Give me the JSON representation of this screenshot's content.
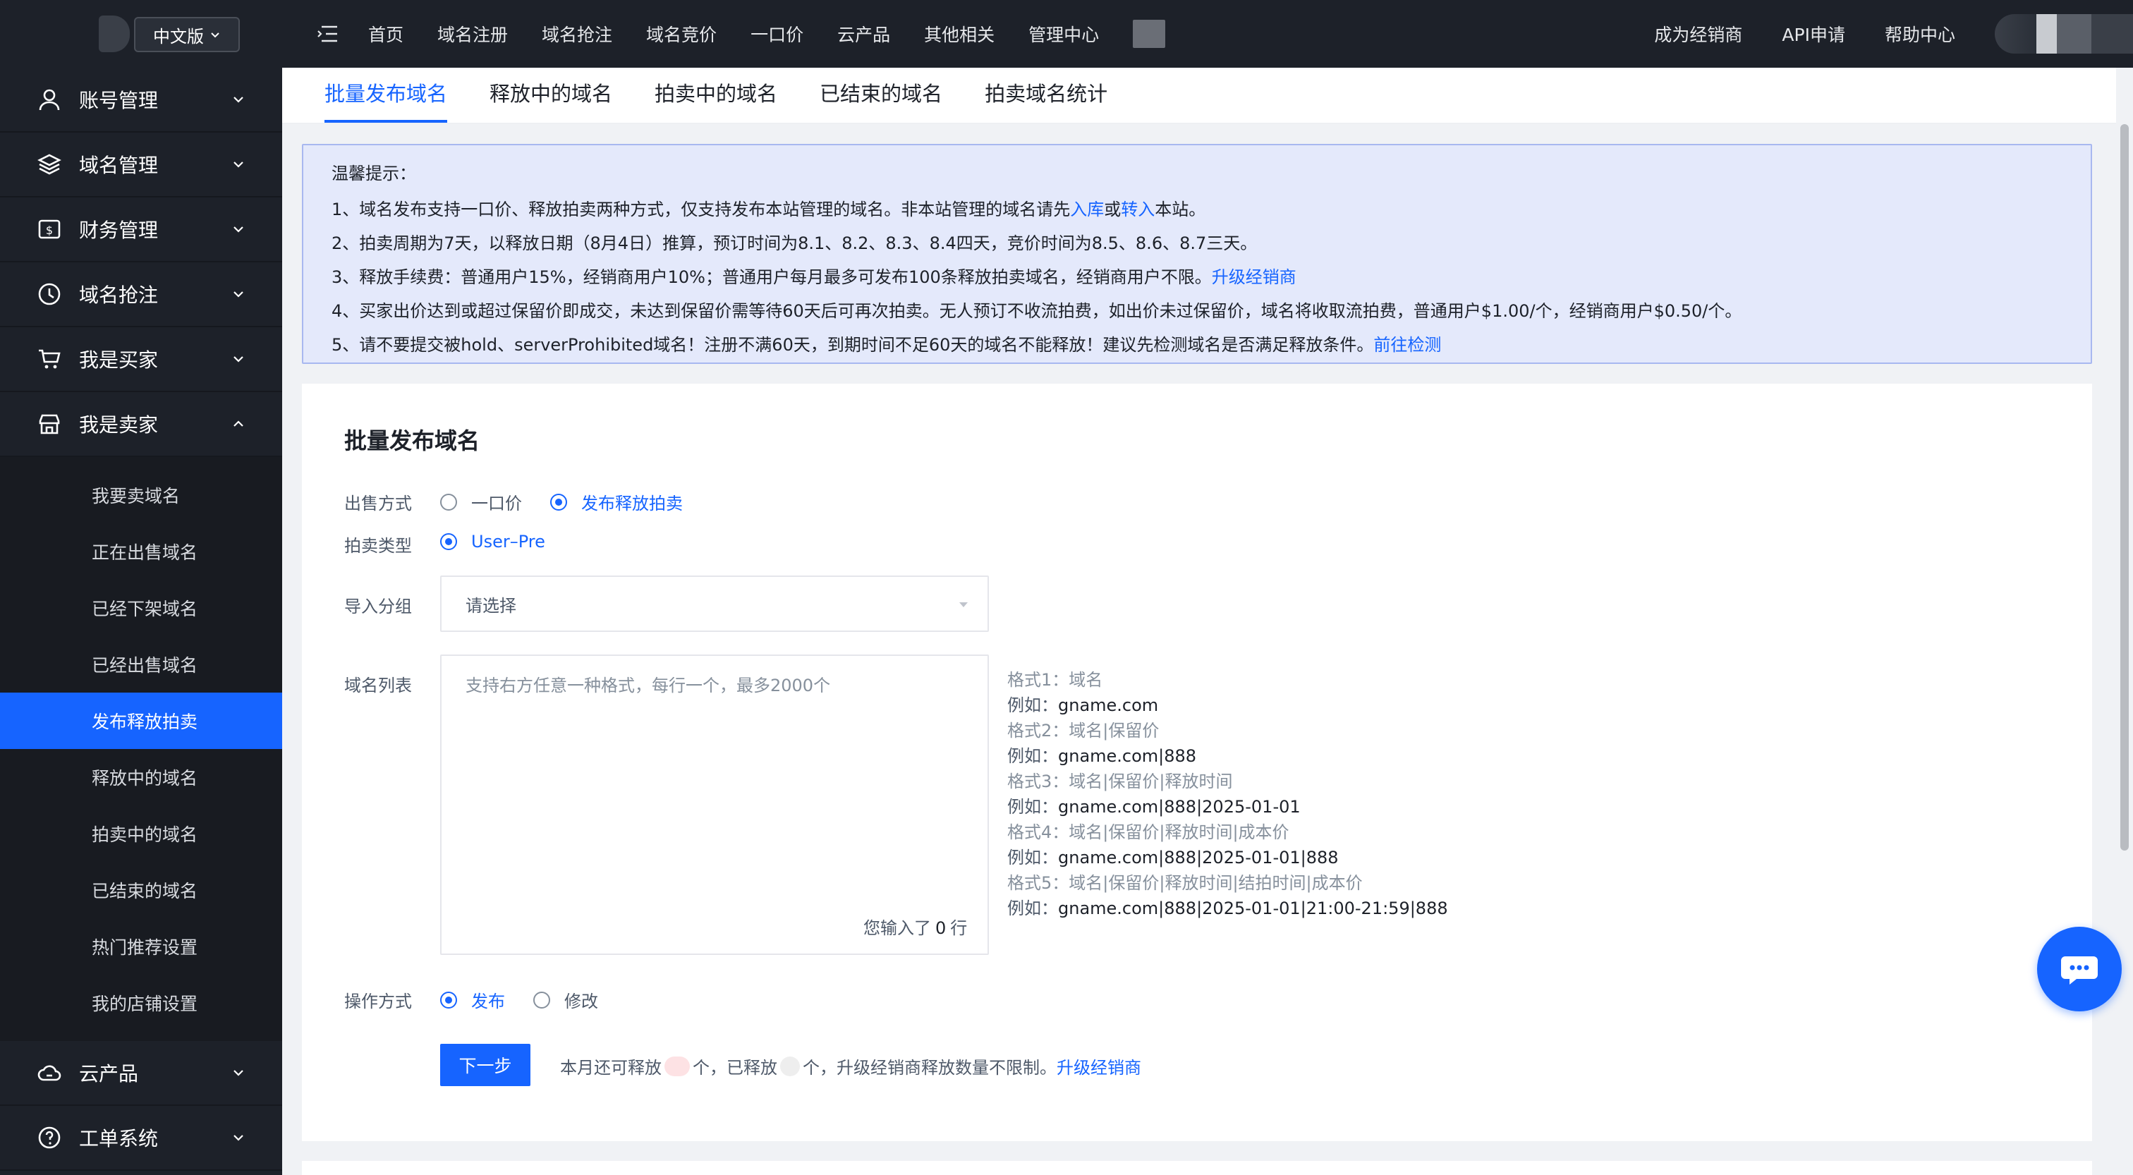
{
  "sidebar": {
    "lang": "中文版",
    "groups": [
      {
        "label": "账号管理"
      },
      {
        "label": "域名管理"
      },
      {
        "label": "财务管理"
      },
      {
        "label": "域名抢注"
      },
      {
        "label": "我是买家"
      },
      {
        "label": "我是卖家"
      }
    ],
    "seller_items": [
      "我要卖域名",
      "正在出售域名",
      "已经下架域名",
      "已经出售域名",
      "发布释放拍卖",
      "释放中的域名",
      "拍卖中的域名",
      "已结束的域名",
      "热门推荐设置",
      "我的店铺设置"
    ],
    "bottom_groups": [
      {
        "label": "云产品"
      },
      {
        "label": "工单系统"
      }
    ]
  },
  "topbar": {
    "nav": [
      "首页",
      "域名注册",
      "域名抢注",
      "域名竞价",
      "一口价",
      "云产品",
      "其他相关",
      "管理中心"
    ],
    "right": [
      "成为经销商",
      "API申请",
      "帮助中心"
    ]
  },
  "tabs": [
    "批量发布域名",
    "释放中的域名",
    "拍卖中的域名",
    "已结束的域名",
    "拍卖域名统计"
  ],
  "notice": {
    "title": "温馨提示：",
    "line1_a": "1、域名发布支持一口价、释放拍卖两种方式，仅支持发布本站管理的域名。非本站管理的域名请先",
    "line1_link1": "入库",
    "line1_b": "或",
    "line1_link2": "转入",
    "line1_c": "本站。",
    "line2": "2、拍卖周期为7天，以释放日期（8月4日）推算，预订时间为8.1、8.2、8.3、8.4四天，竞价时间为8.5、8.6、8.7三天。",
    "line3_a": "3、释放手续费：普通用户15%，经销商用户10%；普通用户每月最多可发布100条释放拍卖域名，经销商用户不限。",
    "line3_link": "升级经销商",
    "line4": "4、买家出价达到或超过保留价即成交，未达到保留价需等待60天后可再次拍卖。无人预订不收流拍费，如出价未过保留价，域名将收取流拍费，普通用户$1.00/个，经销商用户$0.50/个。",
    "line5_a": "5、请不要提交被hold、serverProhibited域名！注册不满60天，到期时间不足60天的域名不能释放！建议先检测域名是否满足释放条件。",
    "line5_link": "前往检测"
  },
  "form": {
    "title": "批量发布域名",
    "sale_label": "出售方式",
    "sale_opt1": "一口价",
    "sale_opt2": "发布释放拍卖",
    "auction_label": "拍卖类型",
    "auction_opt": "User–Pre",
    "group_label": "导入分组",
    "group_placeholder": "请选择",
    "list_label": "域名列表",
    "list_placeholder": "支持右方任意一种格式，每行一个，最多2000个",
    "counter_a": "您输入了",
    "counter_n": "0",
    "counter_b": "行",
    "formats": [
      {
        "label": "格式1：域名",
        "ex_pre": "例如：",
        "ex": "gname.com"
      },
      {
        "label": "格式2：域名|保留价",
        "ex_pre": "例如：",
        "ex": "gname.com|888"
      },
      {
        "label": "格式3：域名|保留价|释放时间",
        "ex_pre": "例如：",
        "ex": "gname.com|888|2025-01-01"
      },
      {
        "label": "格式4：域名|保留价|释放时间|成本价",
        "ex_pre": "例如：",
        "ex": "gname.com|888|2025-01-01|888"
      },
      {
        "label": "格式5：域名|保留价|释放时间|结拍时间|成本价",
        "ex_pre": "例如：",
        "ex": "gname.com|888|2025-01-01|21:00-21:59|888"
      }
    ],
    "op_label": "操作方式",
    "op_opt1": "发布",
    "op_opt2": "修改",
    "next_btn": "下一步",
    "quota_a": "本月还可释放",
    "quota_b": "个，已释放",
    "quota_c": "个，升级经销商释放数量不限制。",
    "quota_link": "升级经销商"
  },
  "colors": {
    "primary": "#1664ff",
    "sidebar": "#1d2129",
    "notice_bg": "#e4e9fb"
  }
}
